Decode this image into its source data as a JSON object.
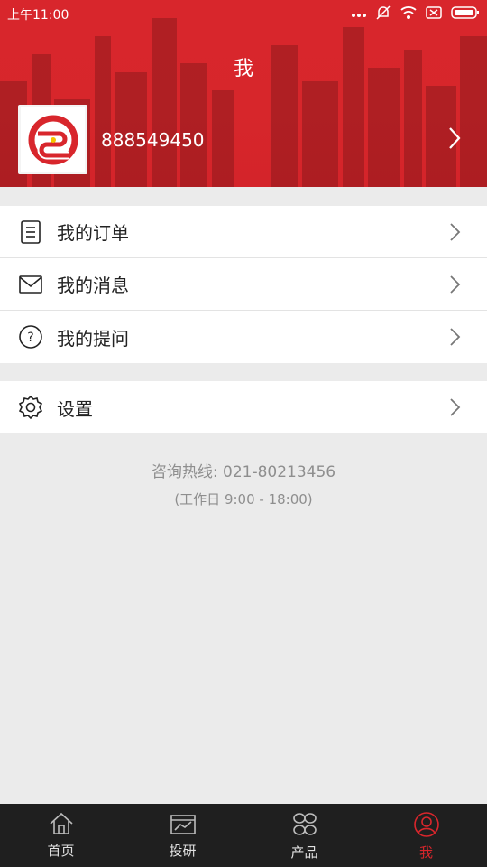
{
  "status": {
    "time": "上午11:00"
  },
  "header": {
    "title": "我",
    "user_id": "888549450"
  },
  "menu": {
    "group1": [
      {
        "label": "我的订单",
        "icon": "document-icon"
      },
      {
        "label": "我的消息",
        "icon": "envelope-icon"
      },
      {
        "label": "我的提问",
        "icon": "question-icon"
      }
    ],
    "group2": [
      {
        "label": "设置",
        "icon": "gear-icon"
      }
    ]
  },
  "hotline": {
    "text": "咨询热线: 021-80213456",
    "hours": "(工作日 9:00 - 18:00)"
  },
  "tabs": [
    {
      "label": "首页",
      "icon": "home-icon",
      "active": false
    },
    {
      "label": "投研",
      "icon": "research-icon",
      "active": false
    },
    {
      "label": "产品",
      "icon": "products-icon",
      "active": false
    },
    {
      "label": "我",
      "icon": "user-icon",
      "active": true
    }
  ],
  "colors": {
    "brand": "#d8262c",
    "tabbar": "#1f1f1f",
    "background": "#ebebeb"
  }
}
